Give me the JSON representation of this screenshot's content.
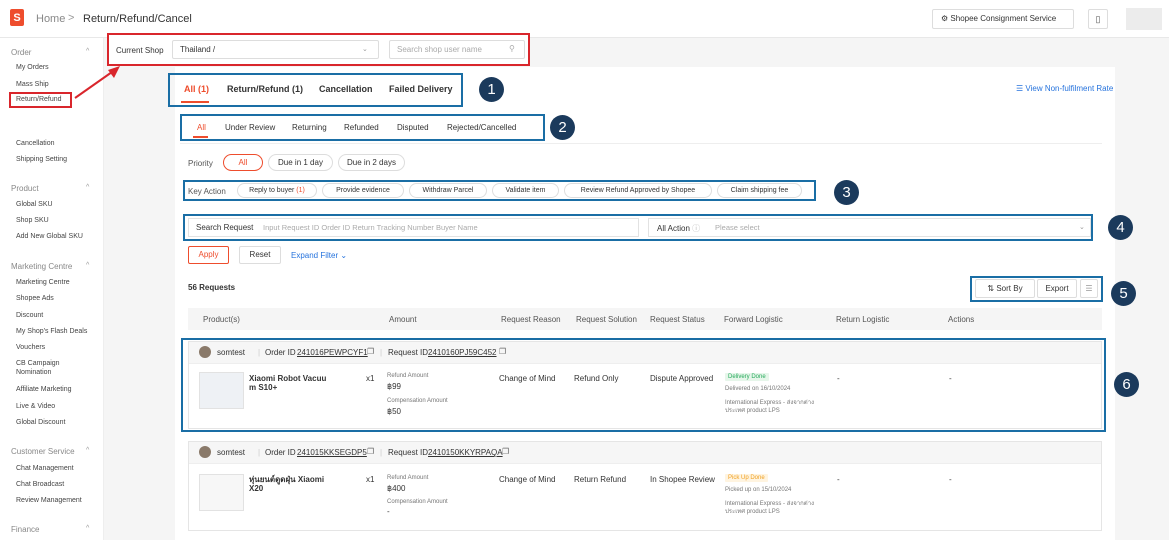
{
  "header": {
    "logo_text": "S",
    "breadcrumb_home": "Home",
    "breadcrumb_sep": ">",
    "breadcrumb_current": "Return/Refund/Cancel",
    "consign_label": "Shopee Consignment Service",
    "book_icon": "book-icon"
  },
  "sidebar": {
    "order": {
      "title": "Order",
      "items": [
        "My Orders",
        "Mass Ship",
        "Return/Refund",
        "Cancellation",
        "Shipping Setting"
      ]
    },
    "product": {
      "title": "Product",
      "items": [
        "Global SKU",
        "Shop SKU",
        "Add New Global SKU"
      ]
    },
    "marketing": {
      "title": "Marketing Centre",
      "items": [
        "Marketing Centre",
        "Shopee Ads",
        "Discount",
        "My Shop's Flash Deals",
        "Vouchers",
        "CB Campaign Nomination",
        "Affiliate Marketing",
        "Live & Video",
        "Global Discount"
      ]
    },
    "customer": {
      "title": "Customer Service",
      "items": [
        "Chat Management",
        "Chat Broadcast",
        "Review Management"
      ]
    },
    "finance": {
      "title": "Finance"
    }
  },
  "shop": {
    "label": "Current Shop",
    "selected": "Thailand /",
    "search_placeholder": "Search shop user name"
  },
  "main_tabs": [
    "All (1)",
    "Return/Refund (1)",
    "Cancellation",
    "Failed Delivery"
  ],
  "sub_tabs": [
    "All",
    "Under Review",
    "Returning",
    "Refunded",
    "Disputed",
    "Rejected/Cancelled"
  ],
  "view_rate": "View Non-fulfilment Rate",
  "priority": {
    "label": "Priority",
    "options": [
      "All",
      "Due in 1 day",
      "Due in 2 days"
    ]
  },
  "key_action": {
    "label": "Key Action",
    "reply": "Reply to buyer",
    "reply_count": "(1)",
    "items": [
      "Provide evidence",
      "Withdraw Parcel",
      "Validate item",
      "Review Refund Approved by Shopee",
      "Claim shipping fee"
    ]
  },
  "search": {
    "label": "Search Request",
    "placeholder": "Input Request ID Order ID Return Tracking Number Buyer Name",
    "action_label": "All Action",
    "action_placeholder": "Please select"
  },
  "buttons": {
    "apply": "Apply",
    "reset": "Reset",
    "expand": "Expand Filter ⌄",
    "sort": "⇅  Sort By",
    "export": "Export",
    "list": "☰"
  },
  "requests_count": "56 Requests",
  "columns": [
    "Product(s)",
    "Amount",
    "Request Reason",
    "Request Solution",
    "Request Status",
    "Forward Logistic",
    "Return Logistic",
    "Actions"
  ],
  "markers": [
    "1",
    "2",
    "3",
    "4",
    "5",
    "6"
  ],
  "rows": [
    {
      "buyer": "somtest",
      "order_label": "Order ID",
      "order_id": "241016PEWPCYF1",
      "request_label": "Request ID",
      "request_id": "2410160PJ59C452",
      "product": "Xiaomi Robot Vacuu m S10+",
      "qty": "x1",
      "refund_label": "Refund Amount",
      "refund": "฿99",
      "comp_label": "Compensation Amount",
      "comp": "฿50",
      "reason": "Change of Mind",
      "solution": "Refund Only",
      "status": "Dispute Approved",
      "fwd_badge": "Delivery Done",
      "fwd_date": "Delivered on 16/10/2024",
      "fwd_carrier": "International Express - ส่งจากต่าง",
      "fwd_carrier2": "ประเทศ product LPS",
      "return_logistic": "-",
      "actions": "-"
    },
    {
      "buyer": "somtest",
      "order_label": "Order ID",
      "order_id": "241015KKSEGDP5",
      "request_label": "Request ID",
      "request_id": "2410150KKYRPAQA",
      "product": "หุ่นยนต์ดูดฝุ่น Xiaomi X20",
      "qty": "x1",
      "refund_label": "Refund Amount",
      "refund": "฿400",
      "comp_label": "Compensation Amount",
      "comp": "-",
      "reason": "Change of Mind",
      "solution": "Return Refund",
      "status": "In Shopee Review",
      "fwd_badge": "Pick Up Done",
      "fwd_date": "Picked up on 15/10/2024",
      "fwd_carrier": "International Express - ส่งจากต่าง",
      "fwd_carrier2": "ประเทศ product LPS",
      "return_logistic": "-",
      "actions": "-"
    }
  ]
}
